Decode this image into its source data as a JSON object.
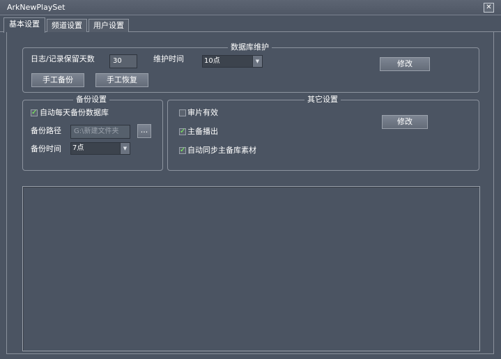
{
  "window": {
    "title": "ArkNewPlaySet",
    "close_glyph": "✕"
  },
  "tabs": [
    {
      "label": "基本设置",
      "active": true
    },
    {
      "label": "频道设置",
      "active": false
    },
    {
      "label": "用户设置",
      "active": false
    }
  ],
  "db_maintenance": {
    "title": "数据库维护",
    "retain_days_label": "日志/记录保留天数",
    "retain_days_value": "30",
    "maintain_time_label": "维护时间",
    "maintain_time_value": "10点",
    "manual_backup_button": "手工备份",
    "manual_restore_button": "手工恢复",
    "modify_button": "修改"
  },
  "backup_settings": {
    "title": "备份设置",
    "auto_backup_label": "自动每天备份数据库",
    "auto_backup_checked": true,
    "path_label": "备份路径",
    "path_value": "G:\\新建文件夹",
    "browse_button": "...",
    "time_label": "备份时间",
    "time_value": "7点"
  },
  "other_settings": {
    "title": "其它设置",
    "items": [
      {
        "label": "审片有效",
        "checked": false
      },
      {
        "label": "主备播出",
        "checked": true
      },
      {
        "label": "自动同步主备库素材",
        "checked": true
      }
    ],
    "modify_button": "修改"
  },
  "icons": {
    "dropdown": "chevron-down-icon",
    "check": "check-icon",
    "close": "close-icon"
  }
}
